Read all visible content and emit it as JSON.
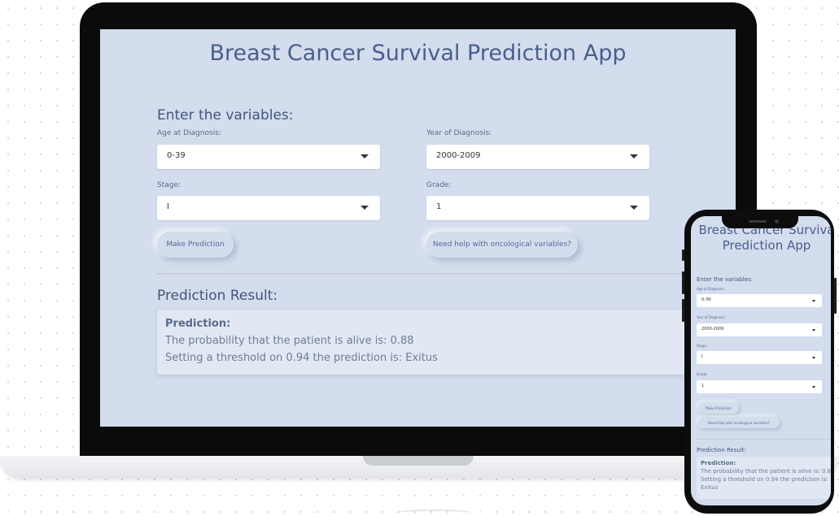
{
  "app": {
    "title": "Breast Cancer Survival Prediction App"
  },
  "form": {
    "section_title": "Enter the variables:",
    "age": {
      "label": "Age at Diagnosis:",
      "value": "0-39"
    },
    "year": {
      "label": "Year of Diagnosis:",
      "value": "2000-2009"
    },
    "stage": {
      "label": "Stage:",
      "value": "I"
    },
    "grade": {
      "label": "Grade:",
      "value": "1"
    },
    "predict_button": "Make Prediction",
    "help_button": "Need help with oncological variables?"
  },
  "result": {
    "section_title": "Prediction Result:",
    "heading": "Prediction:",
    "probability_line": "The probability that the patient is alive is: 0.88",
    "threshold_line": "Setting a threshold on 0.94 the prediction is: Exitus"
  },
  "mobile": {
    "title_line1": "Breast Cancer Surviva",
    "title_line2": "Prediction App",
    "probability_line": "The probability that the patient is alive is: 0.8",
    "threshold_line1": "Setting a threshold on 0.94 the prediction is:",
    "threshold_line2": "Exitus"
  },
  "icons": {
    "dropdown": "chevron-down-icon"
  },
  "colors": {
    "page_bg": "#d3dded",
    "title": "#4b5e8c",
    "device": "#0b0b0b"
  }
}
